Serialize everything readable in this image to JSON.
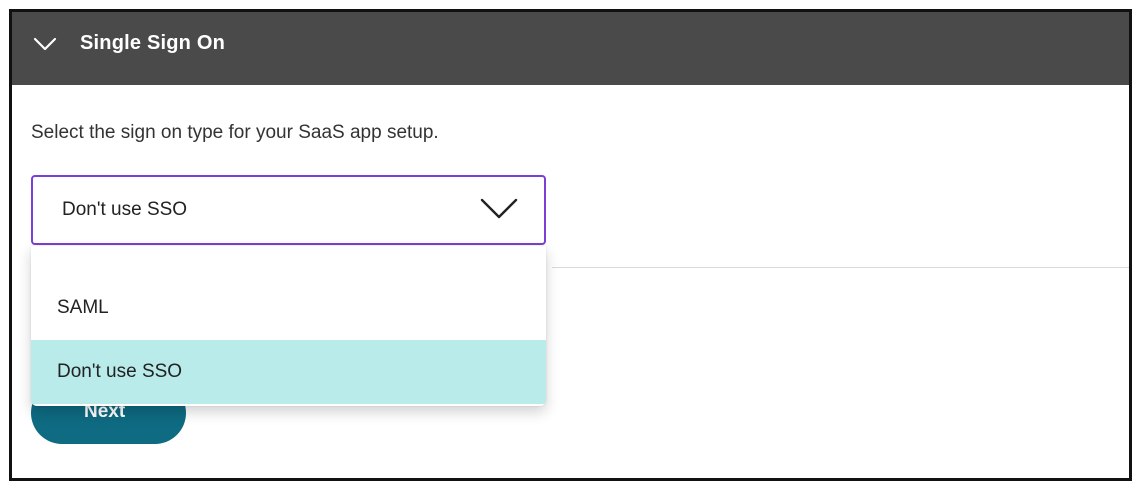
{
  "header": {
    "title": "Single Sign On",
    "expand_icon": "chevron-down-icon",
    "background": "#4a4a4a"
  },
  "instruction": "Select the sign on type for your SaaS app setup.",
  "sign_on_select": {
    "value": "Don't use SSO",
    "icon": "chevron-down-icon",
    "border_color": "#7a3fd6",
    "options": [
      {
        "label": "SAML",
        "selected": false
      },
      {
        "label": "Don't use SSO",
        "selected": true
      }
    ],
    "selected_color": "#b8ebea"
  },
  "actions": {
    "next_label": "Next",
    "next_color": "#0e6b82"
  }
}
